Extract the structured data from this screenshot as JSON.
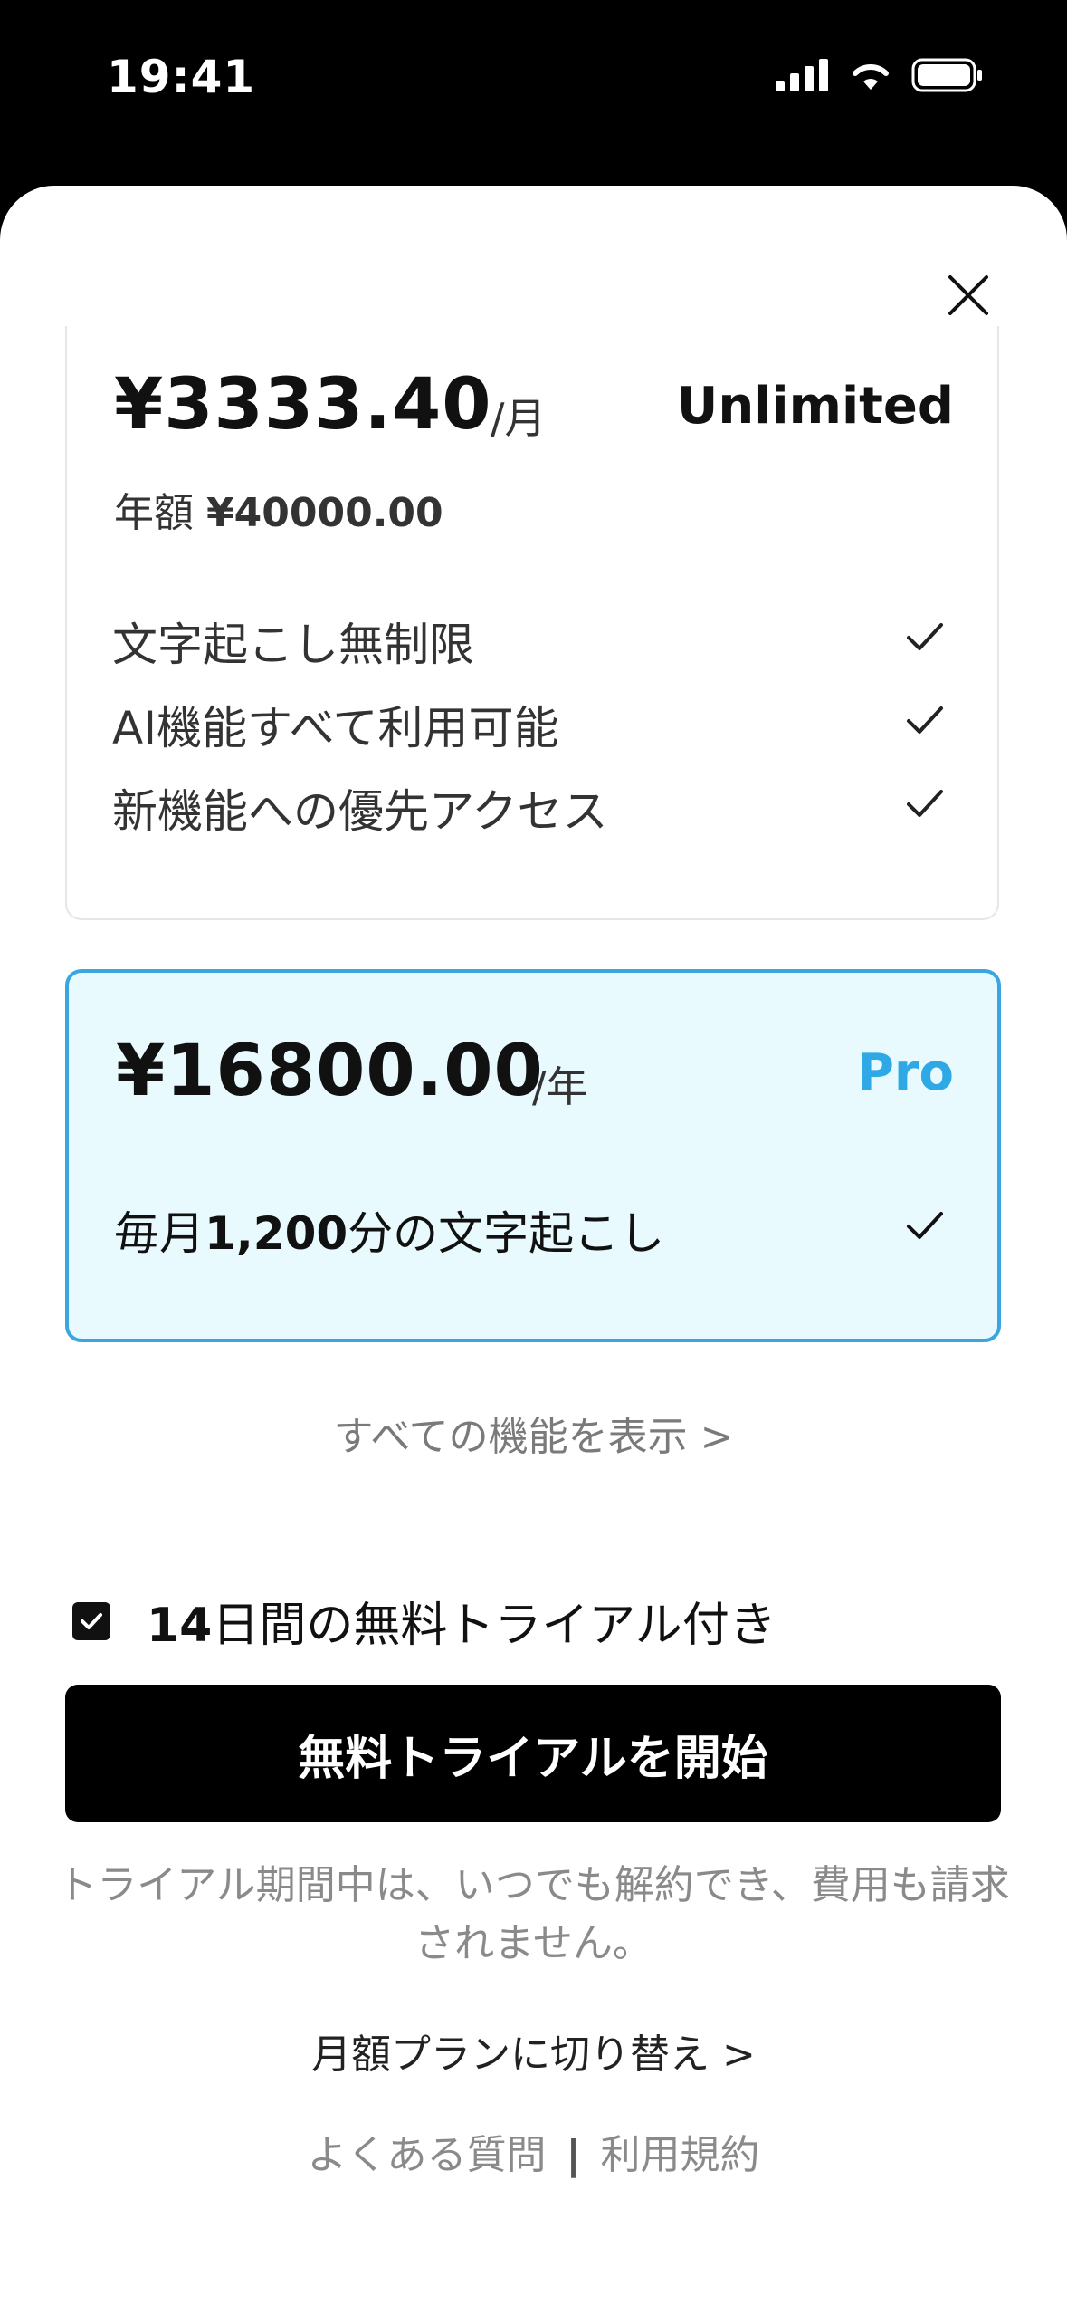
{
  "status_bar": {
    "time": "19:41",
    "icons": [
      "cellular-icon",
      "wifi-icon",
      "battery-icon"
    ]
  },
  "close_icon": "close-icon",
  "plans": [
    {
      "name": "Unlimited",
      "price": "¥3333.40",
      "price_unit": "/月",
      "annual_label": "年額",
      "annual_price": "¥40000.00",
      "features": [
        "文字起こし無制限",
        "AI機能すべて利用可能",
        "新機能への優先アクセス"
      ],
      "name_color": "#111111"
    },
    {
      "name": "Pro",
      "price": "¥16800.00",
      "price_unit": "/年",
      "features_prefix": "毎月",
      "features_bold": "1,200",
      "features_suffix": "分の文字起こし",
      "name_color": "#2ea9e6",
      "selected": true
    }
  ],
  "show_all_features": "すべての機能を表示 >",
  "trial": {
    "checked": true,
    "label_bold": "14",
    "label": "日間の無料トライアル付き"
  },
  "cta_label": "無料トライアルを開始",
  "trial_note": "トライアル期間中は、いつでも解約でき、費用も請求されません。",
  "switch_plan": "月額プランに切り替え >",
  "footer": {
    "faq": "よくある質問",
    "separator": "|",
    "terms": "利用規約"
  },
  "colors": {
    "accent": "#3aa6e0",
    "selected_bg": "#e8fafd",
    "button_bg": "#000000"
  }
}
